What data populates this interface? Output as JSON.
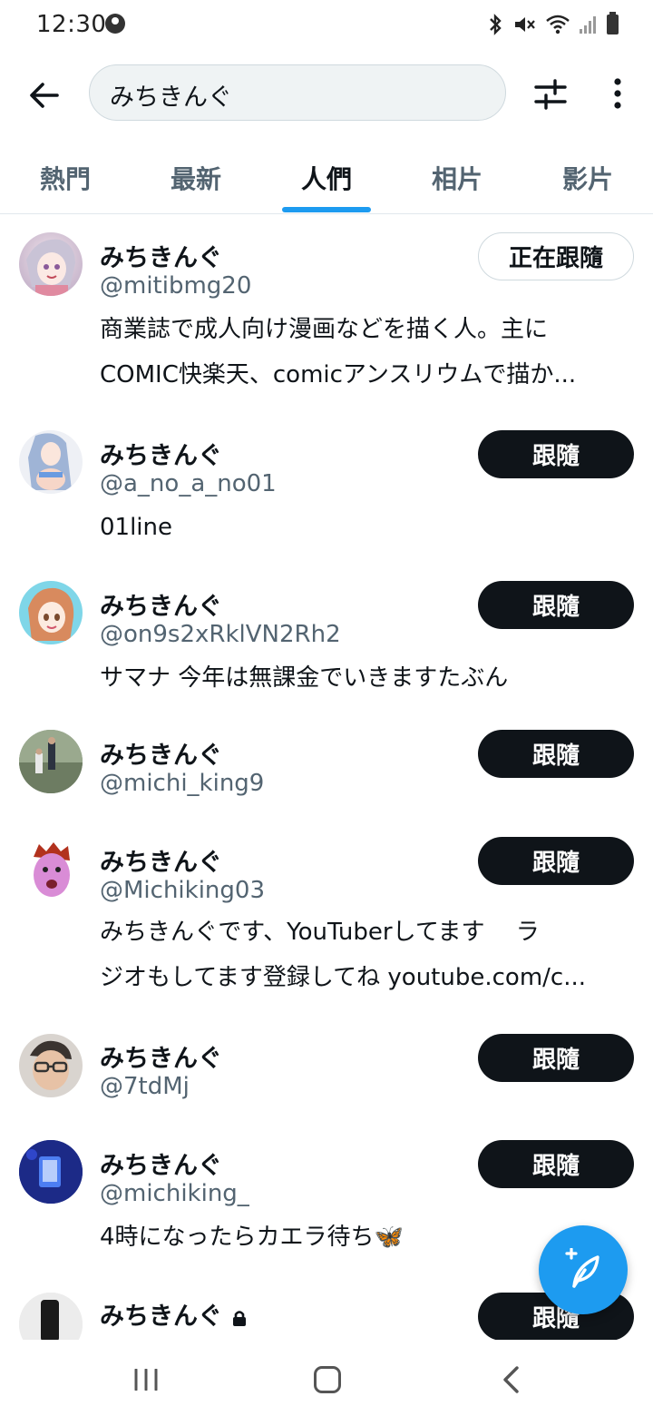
{
  "status_bar": {
    "time": "12:30"
  },
  "search": {
    "query": "みちきんぐ"
  },
  "tabs": [
    {
      "label": "熱門",
      "active": false
    },
    {
      "label": "最新",
      "active": false
    },
    {
      "label": "人們",
      "active": true
    },
    {
      "label": "相片",
      "active": false
    },
    {
      "label": "影片",
      "active": false
    }
  ],
  "users": [
    {
      "name": "みちきんぐ",
      "handle": "@mitibmg20",
      "bio": [
        "商業誌で成人向け漫画などを描く人。主に",
        "COMIC快楽天、comicアンスリウムで描か..."
      ],
      "button": "正在跟隨",
      "following": true,
      "protected": false
    },
    {
      "name": "みちきんぐ",
      "handle": "@a_no_a_no01",
      "bio": [
        "01line"
      ],
      "button": "跟隨",
      "following": false,
      "protected": false
    },
    {
      "name": "みちきんぐ",
      "handle": "@on9s2xRklVN2Rh2",
      "bio": [
        "サマナ 今年は無課金でいきますたぶん"
      ],
      "button": "跟隨",
      "following": false,
      "protected": false
    },
    {
      "name": "みちきんぐ",
      "handle": "@michi_king9",
      "bio": [],
      "button": "跟隨",
      "following": false,
      "protected": false
    },
    {
      "name": "みちきんぐ",
      "handle": "@Michiking03",
      "bio": [
        "みちきんぐです、YouTuberしてます　 ラ",
        "ジオもしてます登録してね youtube.com/c..."
      ],
      "button": "跟隨",
      "following": false,
      "protected": false
    },
    {
      "name": "みちきんぐ",
      "handle": "@7tdMj",
      "bio": [],
      "button": "跟隨",
      "following": false,
      "protected": false
    },
    {
      "name": "みちきんぐ",
      "handle": "@michiking_",
      "bio": [
        "4時になったらカエラ待ち🦋"
      ],
      "button": "跟隨",
      "following": false,
      "protected": false
    },
    {
      "name": "みちきんぐ",
      "handle": "",
      "bio": [],
      "button": "跟隨",
      "following": false,
      "protected": true
    }
  ],
  "colors": {
    "accent": "#1d9bf0",
    "text_primary": "#0f1419",
    "text_secondary": "#536471",
    "follow_button_bg": "#0f1419"
  },
  "icons": {
    "back": "arrow-left-icon",
    "filter": "sliders-icon",
    "more": "vertical-dots-icon",
    "compose": "feather-plus-icon",
    "lock": "lock-icon"
  }
}
